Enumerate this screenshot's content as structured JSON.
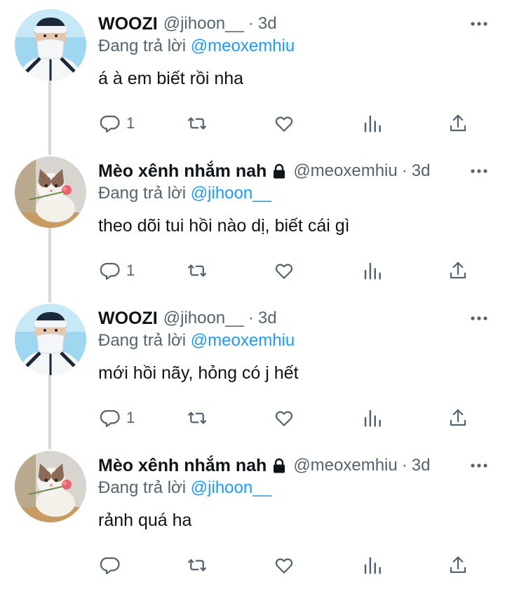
{
  "tweets": [
    {
      "author": "WOOZI",
      "handle": "@jihoon__",
      "time": "3d",
      "replying_label": "Đang trả lời",
      "replying_to": "@meoxemhiu",
      "text": "á à em biết rồi nha",
      "replies": "1",
      "locked": false,
      "avatar": "woozi"
    },
    {
      "author": "Mèo xênh nhắm nah",
      "handle": "@meoxemhiu",
      "time": "3d",
      "replying_label": "Đang trả lời",
      "replying_to": "@jihoon__",
      "text": "theo dõi tui hồi nào dị, biết cái gì",
      "replies": "1",
      "locked": true,
      "avatar": "cat"
    },
    {
      "author": "WOOZI",
      "handle": "@jihoon__",
      "time": "3d",
      "replying_label": "Đang trả lời",
      "replying_to": "@meoxemhiu",
      "text": "mới hồi nãy, hỏng có j hết",
      "replies": "1",
      "locked": false,
      "avatar": "woozi"
    },
    {
      "author": "Mèo xênh nhắm nah",
      "handle": "@meoxemhiu",
      "time": "3d",
      "replying_label": "Đang trả lời",
      "replying_to": "@jihoon__",
      "text": "rảnh quá ha",
      "replies": "",
      "locked": true,
      "avatar": "cat"
    }
  ],
  "separator": "·",
  "colors": {
    "text": "#0f1419",
    "secondary": "#536471",
    "link": "#1d9bf0",
    "thread_line": "#cfd9de"
  }
}
